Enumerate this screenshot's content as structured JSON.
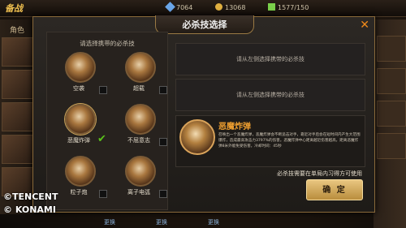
{
  "topbar": {
    "title": "备战",
    "resources": [
      "7064",
      "13068",
      "1577/150"
    ]
  },
  "side": {
    "tab_label": "角色"
  },
  "modal": {
    "title": "必杀技选择",
    "close": "✕",
    "left_hint": "请选择携带的必杀技",
    "skills": [
      {
        "name": "空袭"
      },
      {
        "name": "超载"
      },
      {
        "name": "恶魔炸弹"
      },
      {
        "name": "不屈意志"
      },
      {
        "name": "粒子炮"
      },
      {
        "name": "离子电弧"
      }
    ],
    "selected_mark": "✔",
    "slot_hint_1": "请从左侧选择携带的必杀技",
    "slot_hint_2": "请从左侧选择携带的必杀技",
    "detail": {
      "name": "恶魔炸弹",
      "description": "召唤出一个恶魔炸弹，恶魔炸弹会不断追击对手，靠近对手后会在短时间内产生大范围爆炸，造成最高攻击力3797%的伤害。恶魔炸弹中心距离越近伤害越高，距离恶魔炸弹8米外能免受伤害。冷却时间：45秒"
    },
    "note": "必杀技需要在单局内习得方可使用",
    "confirm": "确 定"
  },
  "watermark": {
    "line1": "©TENCENT",
    "line2": "© KONAMI"
  },
  "bottom_tabs": [
    "更换",
    "更换",
    "更换"
  ],
  "colors": {
    "accent": "#f08a1a",
    "skill_name": "#f0a030",
    "check": "#5ac21a"
  }
}
